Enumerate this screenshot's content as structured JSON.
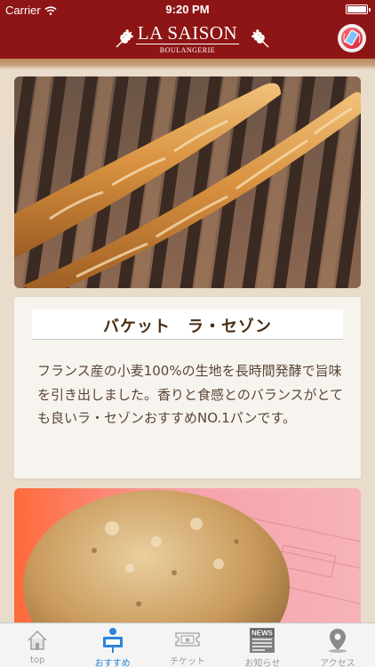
{
  "status_bar": {
    "carrier": "Carrier",
    "time": "9:20 PM"
  },
  "header": {
    "logo_name": "LA SAISON",
    "logo_sub": "BOULANGERIE",
    "phone_icon": "phone-icon"
  },
  "featured": {
    "image_description": "baguettes on wooden slats",
    "title": "バケット　ラ・セゾン",
    "description": "フランス産の小麦100%の生地を長時間発酵で旨味を引き出しました。香りと食感とのバランスがとても良いラ・セゾンおすすめNO.1パンです。"
  },
  "tabs": [
    {
      "label": "top",
      "icon": "house-icon",
      "active": false
    },
    {
      "label": "おすすめ",
      "icon": "recommend-person-icon",
      "active": true
    },
    {
      "label": "チケット",
      "icon": "ticket-icon",
      "active": false
    },
    {
      "label": "お知らせ",
      "icon": "news-icon",
      "active": false
    },
    {
      "label": "アクセス",
      "icon": "map-pin-icon",
      "active": false
    }
  ],
  "colors": {
    "header": "#8e1515",
    "active_tab": "#2a86d9",
    "inactive_tab": "#9b9b9b",
    "title_text": "#4a2e14"
  }
}
